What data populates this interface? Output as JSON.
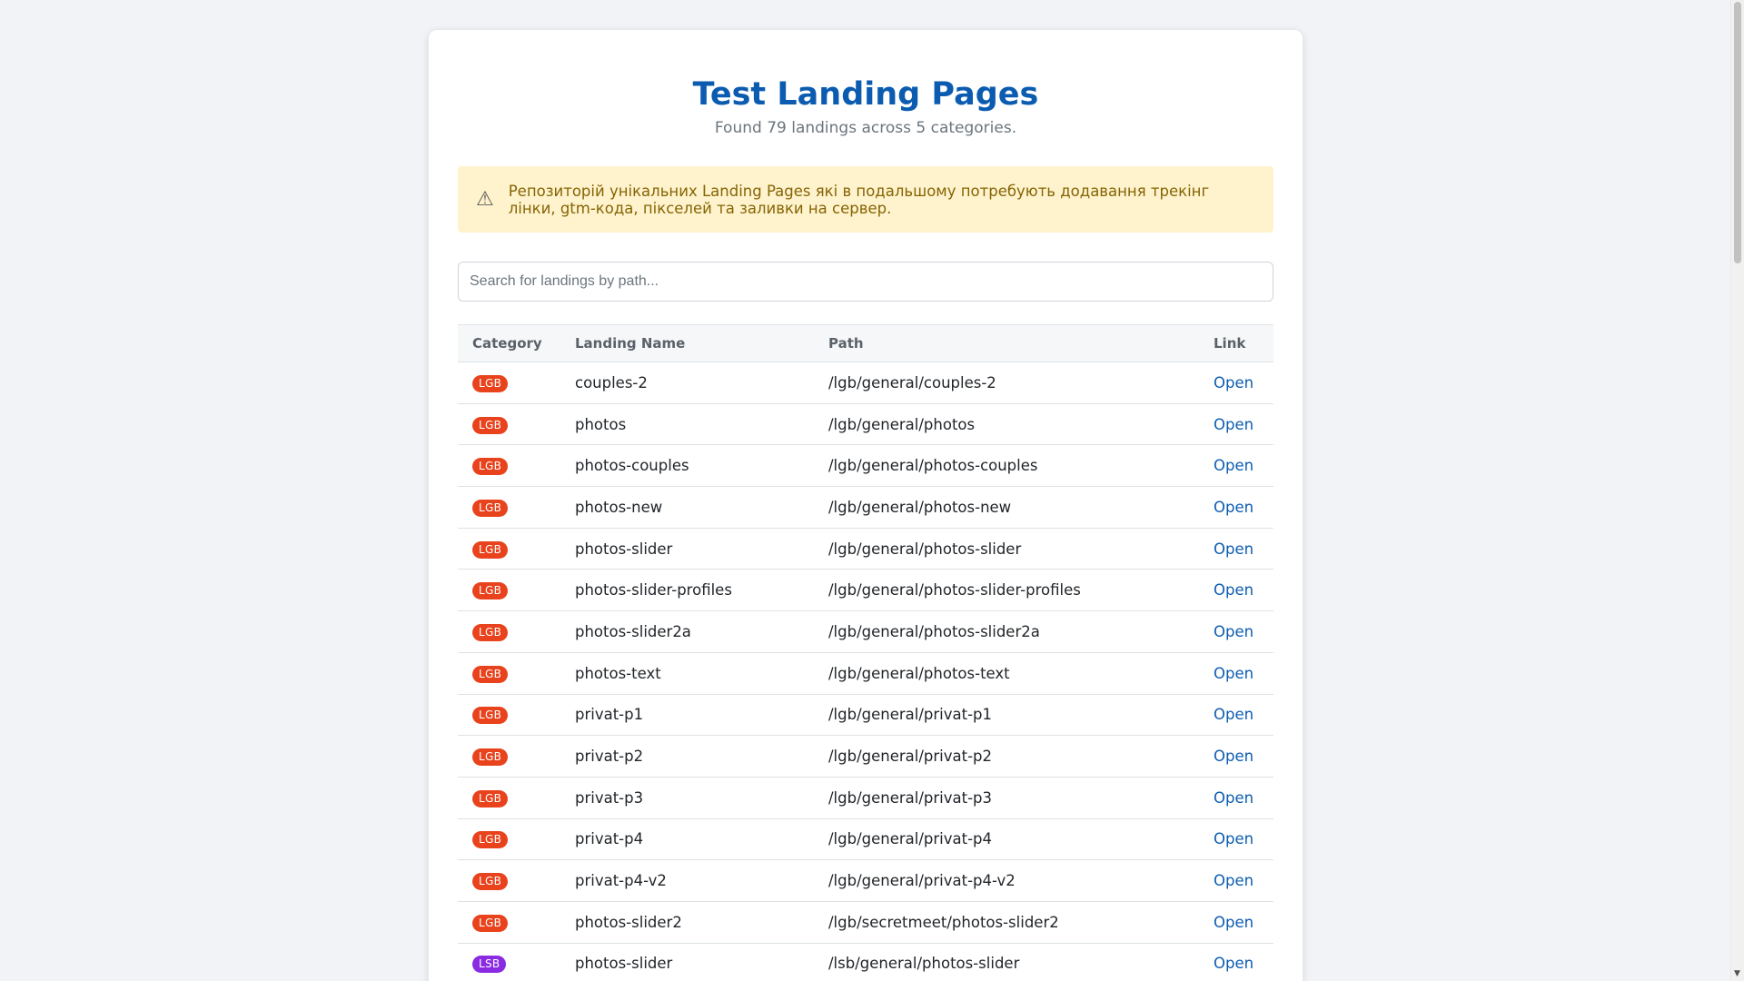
{
  "header": {
    "title": "Test Landing Pages",
    "subtitle": "Found 79 landings across 5 categories."
  },
  "alert": {
    "icon": "warning-icon",
    "text": "Репозиторій унікальних Landing Pages які в подальшому потребують додавання трекінг лінки, gtm-кода, пікселей та заливки на сервер."
  },
  "search": {
    "placeholder": "Search for landings by path...",
    "value": ""
  },
  "table": {
    "headers": {
      "category": "Category",
      "name": "Landing Name",
      "path": "Path",
      "link": "Link"
    },
    "rows": [
      {
        "category": "LGB",
        "name": "couples-2",
        "path": "/lgb/general/couples-2",
        "link": "Open"
      },
      {
        "category": "LGB",
        "name": "photos",
        "path": "/lgb/general/photos",
        "link": "Open"
      },
      {
        "category": "LGB",
        "name": "photos-couples",
        "path": "/lgb/general/photos-couples",
        "link": "Open"
      },
      {
        "category": "LGB",
        "name": "photos-new",
        "path": "/lgb/general/photos-new",
        "link": "Open"
      },
      {
        "category": "LGB",
        "name": "photos-slider",
        "path": "/lgb/general/photos-slider",
        "link": "Open"
      },
      {
        "category": "LGB",
        "name": "photos-slider-profiles",
        "path": "/lgb/general/photos-slider-profiles",
        "link": "Open"
      },
      {
        "category": "LGB",
        "name": "photos-slider2a",
        "path": "/lgb/general/photos-slider2a",
        "link": "Open"
      },
      {
        "category": "LGB",
        "name": "photos-text",
        "path": "/lgb/general/photos-text",
        "link": "Open"
      },
      {
        "category": "LGB",
        "name": "privat-p1",
        "path": "/lgb/general/privat-p1",
        "link": "Open"
      },
      {
        "category": "LGB",
        "name": "privat-p2",
        "path": "/lgb/general/privat-p2",
        "link": "Open"
      },
      {
        "category": "LGB",
        "name": "privat-p3",
        "path": "/lgb/general/privat-p3",
        "link": "Open"
      },
      {
        "category": "LGB",
        "name": "privat-p4",
        "path": "/lgb/general/privat-p4",
        "link": "Open"
      },
      {
        "category": "LGB",
        "name": "privat-p4-v2",
        "path": "/lgb/general/privat-p4-v2",
        "link": "Open"
      },
      {
        "category": "LGB",
        "name": "photos-slider2",
        "path": "/lgb/secretmeet/photos-slider2",
        "link": "Open"
      },
      {
        "category": "LSB",
        "name": "photos-slider",
        "path": "/lsb/general/photos-slider",
        "link": "Open"
      }
    ]
  },
  "colors": {
    "title": "#0b5cb0",
    "link": "#0b5cb0",
    "badge_lgb": "#e8431c",
    "badge_lsb": "#8a2be2",
    "alert_bg": "#fff3cd",
    "alert_text": "#856404"
  }
}
